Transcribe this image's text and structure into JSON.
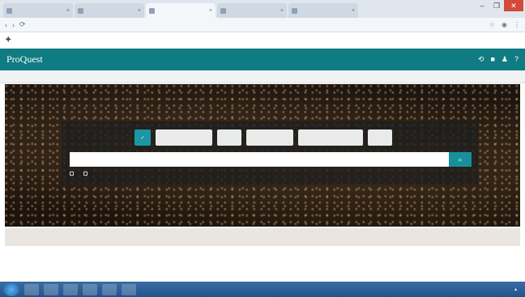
{
  "browser": {
    "tabs": [
      {
        "title": "",
        "active": false
      },
      {
        "title": "",
        "active": false
      },
      {
        "title": "",
        "active": true
      },
      {
        "title": "",
        "active": false
      },
      {
        "title": "",
        "active": false
      }
    ],
    "url": "",
    "window_controls": [
      "–",
      "❐",
      "✕"
    ]
  },
  "institution": {
    "banner_text": ""
  },
  "proquest": {
    "logo": "ProQuest",
    "nav": [
      "",
      "",
      "",
      ""
    ]
  },
  "search": {
    "sources": [
      "",
      "",
      "",
      "",
      "",
      ""
    ],
    "placeholder": "",
    "options": [
      "",
      ""
    ],
    "advanced_link": ""
  },
  "infobar": {
    "parts": [
      "",
      "",
      "",
      "",
      ""
    ]
  },
  "content": {
    "line": ""
  },
  "taskbar": {
    "items": [
      "",
      "",
      "",
      "",
      "",
      ""
    ],
    "clock": ""
  },
  "colors": {
    "teal": "#0f7b82",
    "accent": "#1a97a3"
  }
}
